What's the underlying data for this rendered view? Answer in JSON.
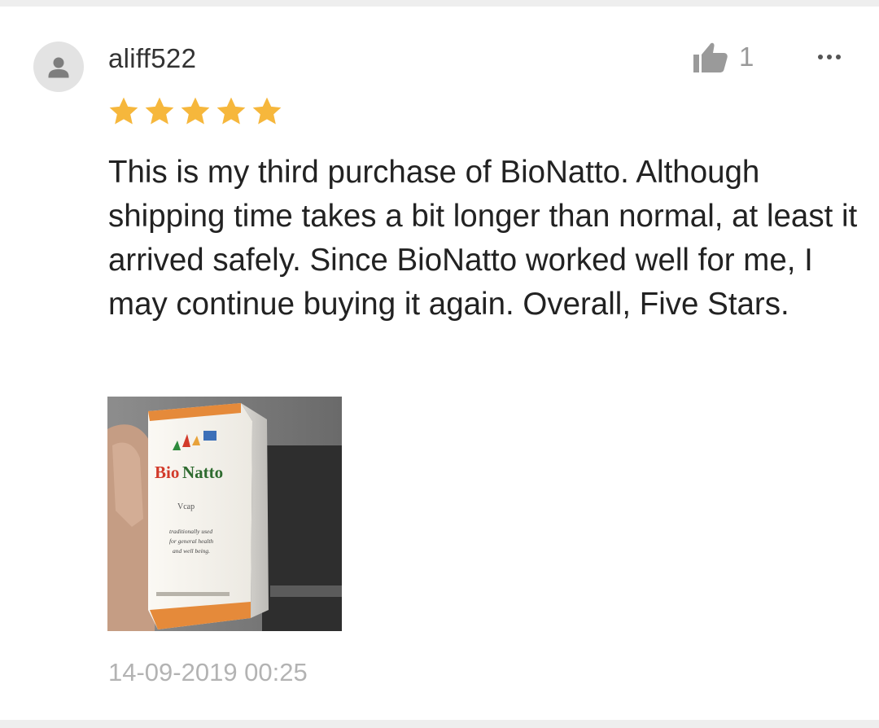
{
  "review": {
    "username": "aliff522",
    "avatar_icon": "user-silhouette-icon",
    "like_icon": "thumbs-up-icon",
    "like_count": "1",
    "more_icon": "more-horizontal-icon",
    "rating": 5,
    "rating_max": 5,
    "star_color": "#f6b73c",
    "text": "This is my third purchase of BioNatto. Although shipping time takes a bit longer than normal, at least it arrived safely. Since BioNatto worked well for me, I may continue buying it again. Overall, Five Stars.",
    "photo": {
      "brand_text": "BioNatto",
      "sub_text": "Vcap",
      "tagline": "traditionally used for general health and well being."
    },
    "timestamp": "14-09-2019 00:25"
  }
}
